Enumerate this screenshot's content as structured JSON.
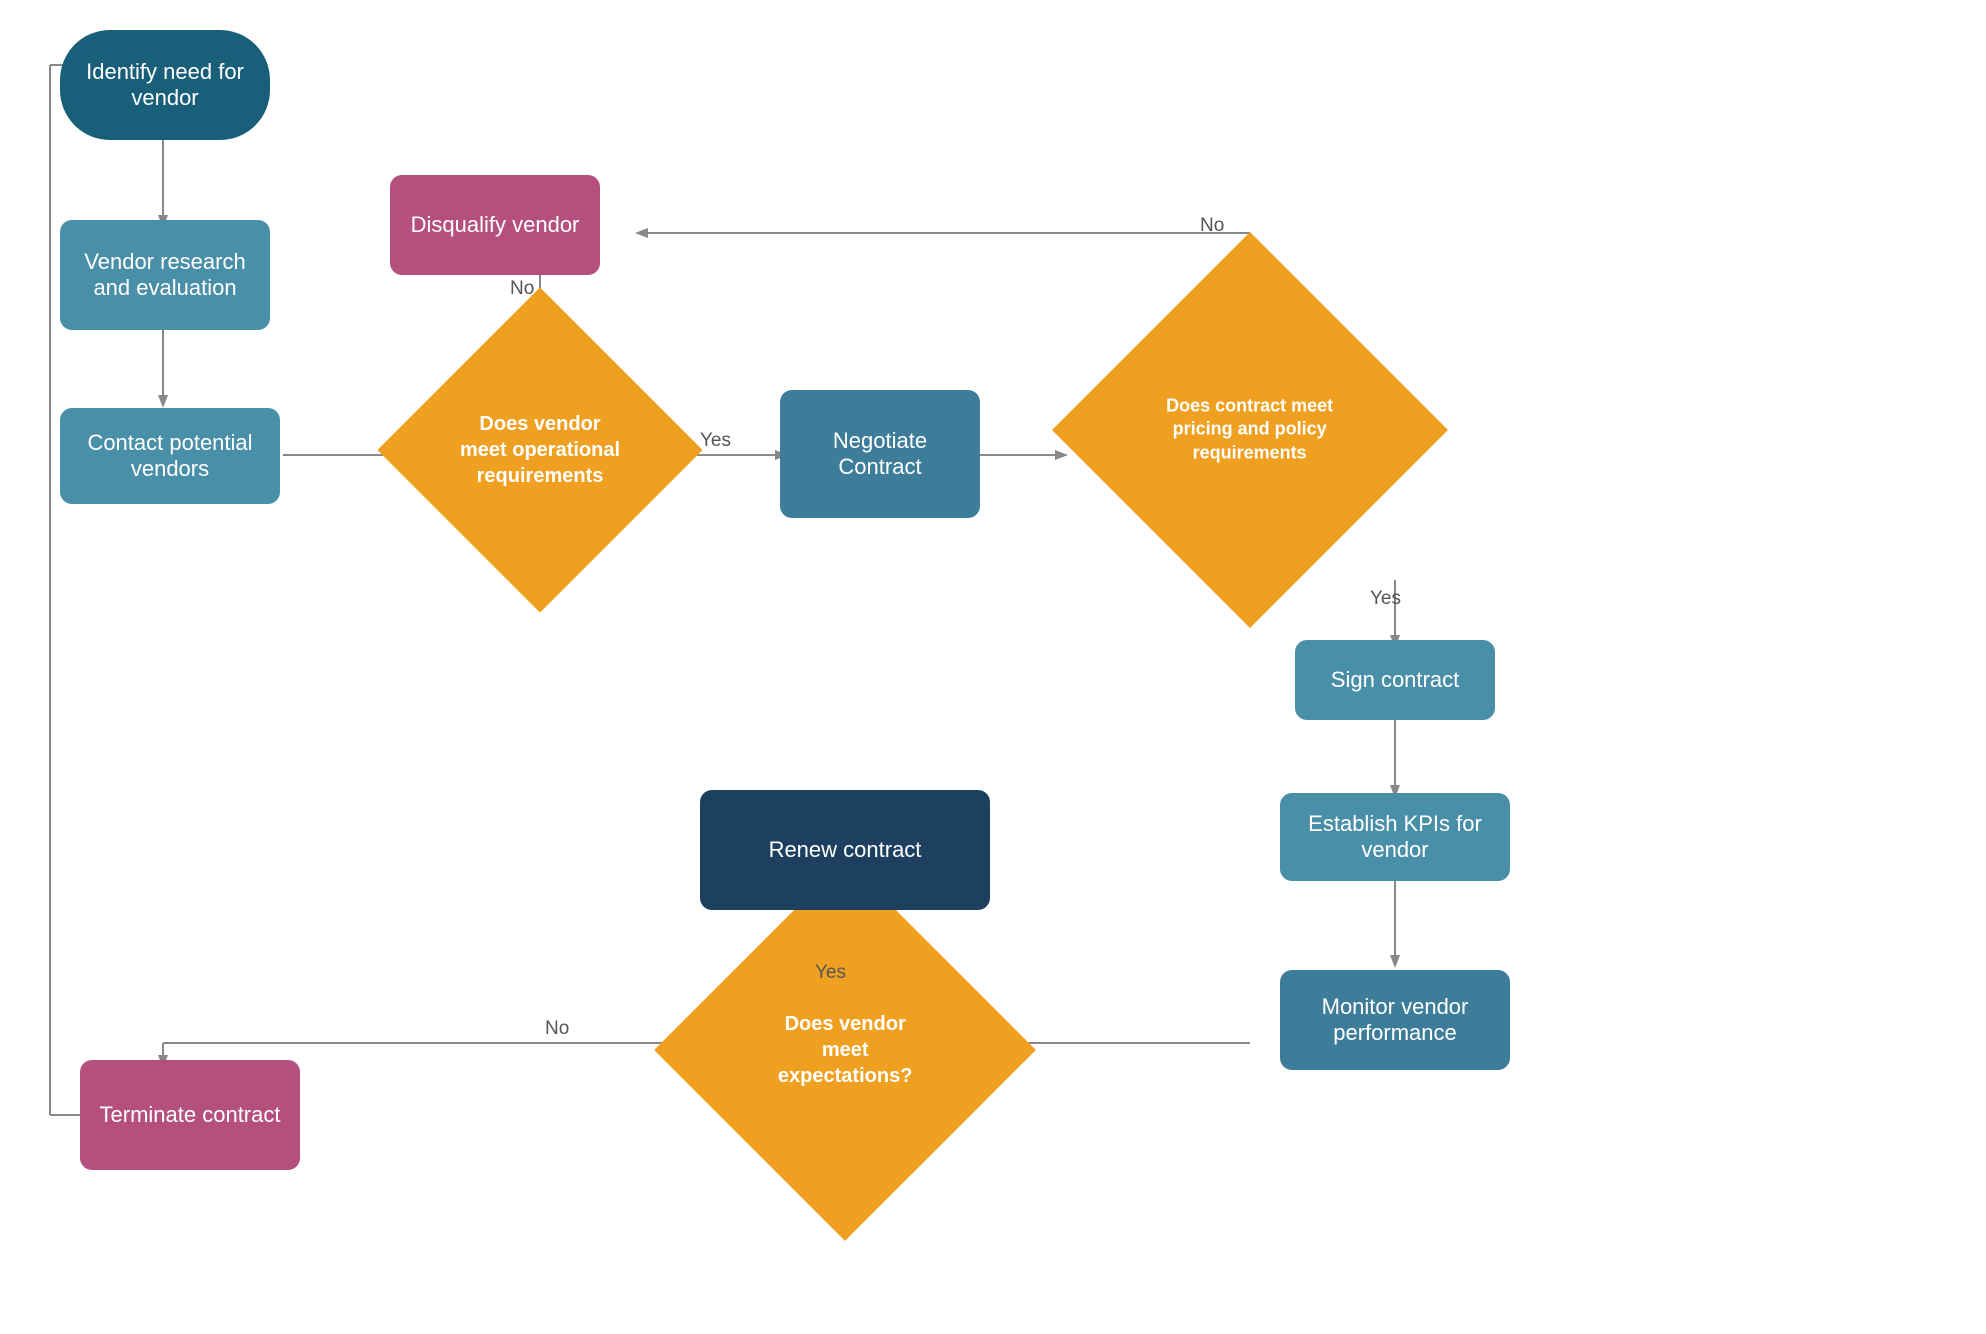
{
  "nodes": {
    "identify_need": {
      "label": "Identify need for\nvendor"
    },
    "vendor_research": {
      "label": "Vendor research\nand evaluation"
    },
    "contact_vendors": {
      "label": "Contact potential\nvendors"
    },
    "disqualify_vendor": {
      "label": "Disqualify vendor"
    },
    "does_vendor_meet_operational": {
      "label": "Does vendor\nmeet operational\nrequirements"
    },
    "negotiate_contract": {
      "label": "Negotiate Contract"
    },
    "does_contract_meet": {
      "label": "Does contract meet\npricing and policy\nrequirements"
    },
    "sign_contract": {
      "label": "Sign contract"
    },
    "establish_kpis": {
      "label": "Establish KPIs for\nvendor"
    },
    "monitor_performance": {
      "label": "Monitor vendor\nperformance"
    },
    "does_vendor_meet_expectations": {
      "label": "Does vendor\nmeet\nexpectations?"
    },
    "renew_contract": {
      "label": "Renew contract"
    },
    "terminate_contract": {
      "label": "Terminate contract"
    }
  },
  "labels": {
    "no1": "No",
    "no2": "No",
    "yes1": "Yes",
    "yes2": "Yes",
    "yes3": "Yes",
    "no3": "No"
  }
}
